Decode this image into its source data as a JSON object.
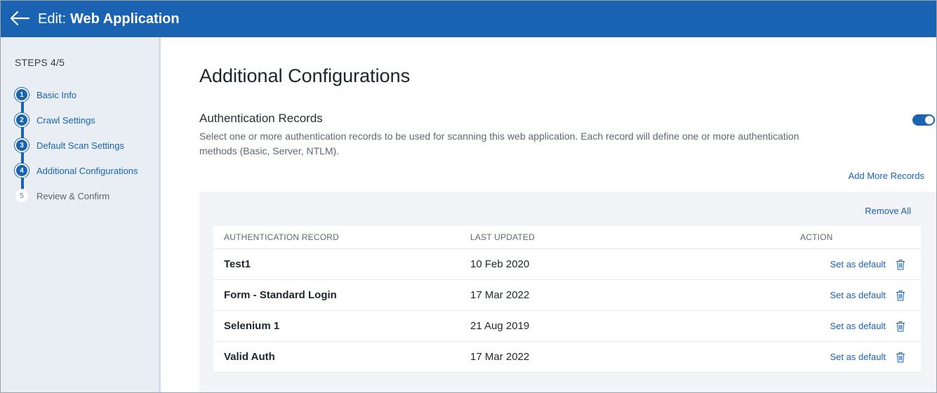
{
  "header": {
    "prefix": "Edit:",
    "title": "Web Application"
  },
  "sidebar": {
    "steps_label": "STEPS 4/5",
    "steps": [
      {
        "num": "1",
        "label": "Basic Info",
        "state": "done"
      },
      {
        "num": "2",
        "label": "Crawl Settings",
        "state": "done"
      },
      {
        "num": "3",
        "label": "Default Scan Settings",
        "state": "done"
      },
      {
        "num": "4",
        "label": "Additional Configurations",
        "state": "current"
      },
      {
        "num": "5",
        "label": "Review & Confirm",
        "state": "pending"
      }
    ]
  },
  "main": {
    "page_title": "Additional Configurations",
    "section_title": "Authentication Records",
    "section_desc": "Select one or more authentication records to be used for scanning this web application. Each record will define one or more authentication methods (Basic, Server, NTLM).",
    "toggle_on": true,
    "add_more": "Add More Records",
    "remove_all": "Remove All",
    "table": {
      "headers": [
        "Authentication Record",
        "Last Updated",
        "Action"
      ],
      "rows": [
        {
          "name": "Test1",
          "date": "10 Feb 2020",
          "action": "Set as default"
        },
        {
          "name": "Form - Standard Login",
          "date": "17 Mar 2022",
          "action": "Set as default"
        },
        {
          "name": "Selenium 1",
          "date": "21 Aug 2019",
          "action": "Set as default"
        },
        {
          "name": "Valid Auth",
          "date": "17 Mar 2022",
          "action": "Set as default"
        }
      ]
    }
  },
  "colors": {
    "accent": "#1a63b3",
    "sidebar_bg": "#e9eef5",
    "panel_bg": "#f2f4f7"
  }
}
